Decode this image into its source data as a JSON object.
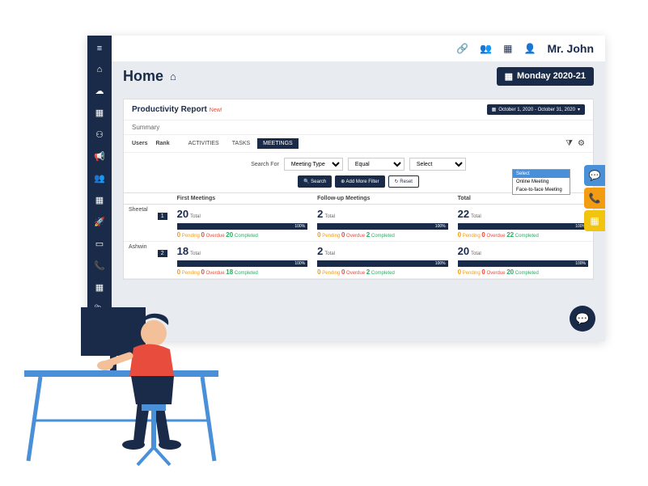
{
  "topbar": {
    "username": "Mr. John"
  },
  "subbar": {
    "home": "Home",
    "date": "Monday 2020-21"
  },
  "report": {
    "title": "Productivity Report",
    "new": "New!",
    "daterange": "October 1, 2020 - October 31, 2020",
    "summary": "Summary"
  },
  "tabs": {
    "users": "Users",
    "rank": "Rank",
    "activities": "Activities",
    "tasks": "Tasks",
    "meetings": "Meetings"
  },
  "search": {
    "label": "Search For",
    "sel1": "Meeting Type",
    "sel2": "Equal",
    "sel3": "Select",
    "btn_search": "🔍 Search",
    "btn_add": "⊕ Add More Filter",
    "btn_reset": "↻ Reset",
    "dropdown": {
      "opt1": "Select",
      "opt2": "Online Meeting",
      "opt3": "Face-to-face Meeting"
    }
  },
  "cols": {
    "first": "First Meetings",
    "followup": "Follow-up Meetings",
    "total": "Total"
  },
  "labels": {
    "total": "Total",
    "pending": "Pending",
    "overdue": "Overdue",
    "completed": "Completed",
    "pct": "100%"
  },
  "rows": [
    {
      "user": "Sheetal",
      "rank": "1",
      "first": {
        "total": "20",
        "pending": "0",
        "overdue": "0",
        "completed": "20"
      },
      "followup": {
        "total": "2",
        "pending": "0",
        "overdue": "0",
        "completed": "2"
      },
      "totalcol": {
        "total": "22",
        "pending": "0",
        "overdue": "0",
        "completed": "22"
      }
    },
    {
      "user": "Ashwin",
      "rank": "2",
      "first": {
        "total": "18",
        "pending": "0",
        "overdue": "0",
        "completed": "18"
      },
      "followup": {
        "total": "2",
        "pending": "0",
        "overdue": "0",
        "completed": "2"
      },
      "totalcol": {
        "total": "20",
        "pending": "0",
        "overdue": "0",
        "completed": "20"
      }
    }
  ]
}
